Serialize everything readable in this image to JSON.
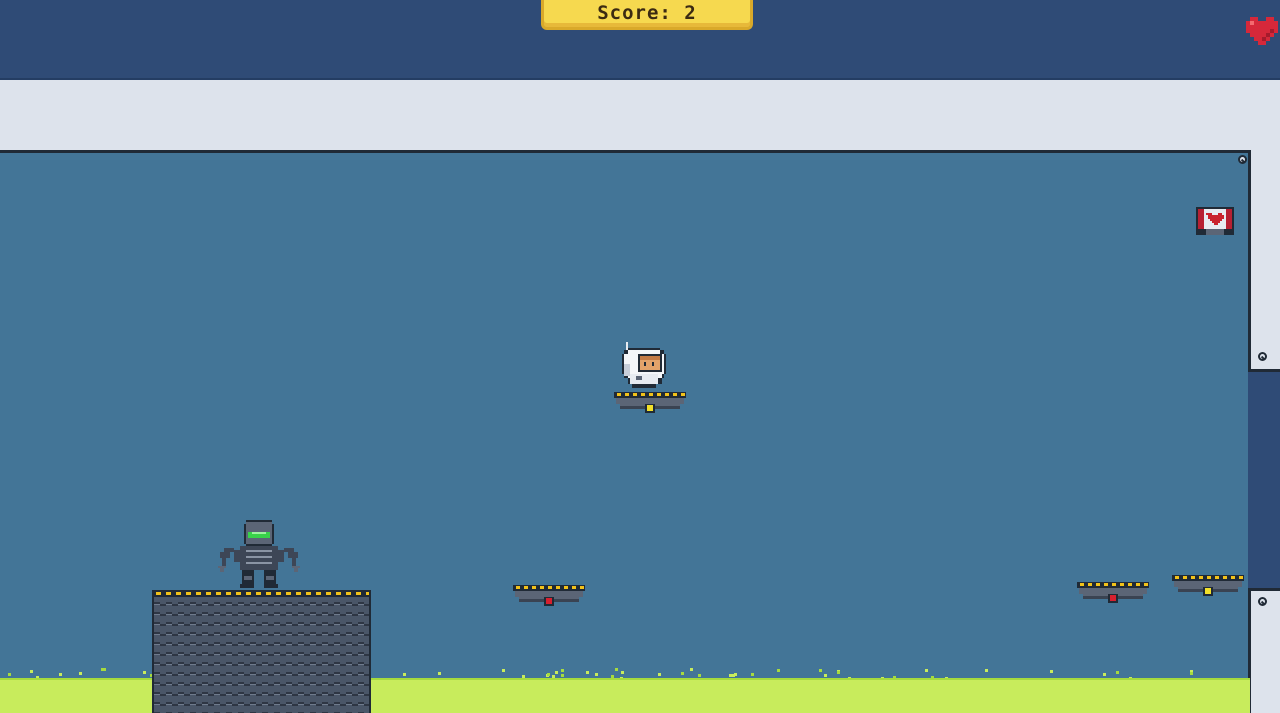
{
  "hud": {
    "score_text": "Score: 2",
    "lives": 1,
    "life_icon": "heart-icon",
    "colors": {
      "hud_bg": "#2f4b76",
      "score_panel": "#f6d94f",
      "heart": "#d6283a"
    }
  },
  "level": {
    "colors": {
      "backdrop": "#437597",
      "metal": "#dde3ec",
      "outline": "#202a36",
      "acid": "#c8ec5c",
      "hazard_yellow": "#f2c21a"
    },
    "platforms": [
      {
        "kind": "tower",
        "light": "none"
      },
      {
        "kind": "floating-pad",
        "light": "yellow"
      },
      {
        "kind": "floating-pad",
        "light": "red"
      },
      {
        "kind": "floating-pad",
        "light": "red"
      },
      {
        "kind": "floating-pad",
        "light": "yellow"
      }
    ],
    "pickups": [
      {
        "kind": "health-crate",
        "icon": "heart-icon"
      }
    ]
  },
  "characters": {
    "player": {
      "kind": "astronaut",
      "facing": "right"
    },
    "enemy": {
      "kind": "armored-robot",
      "visor_color": "#38d14a"
    }
  }
}
